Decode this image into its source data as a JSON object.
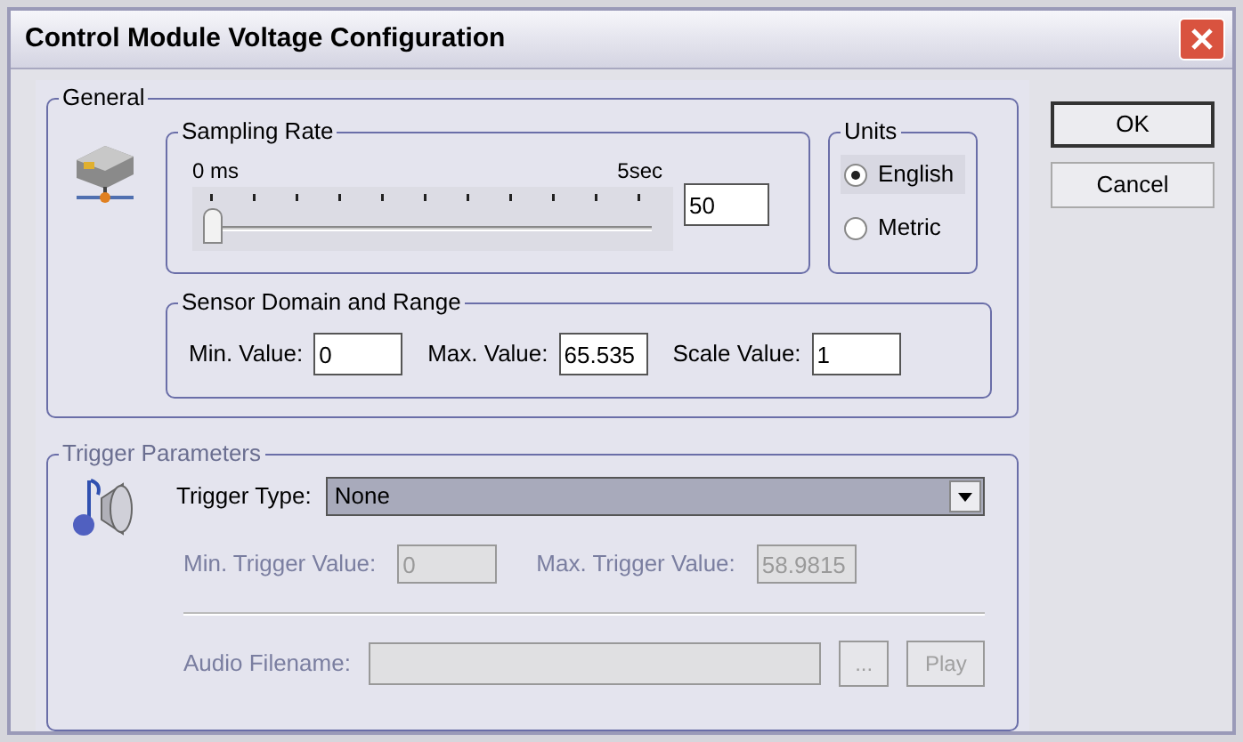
{
  "window": {
    "title": "Control Module Voltage Configuration"
  },
  "general": {
    "legend": "General",
    "sampling_rate": {
      "legend": "Sampling Rate",
      "min_label": "0 ms",
      "max_label": "5sec",
      "level": 0.01,
      "value": "50"
    },
    "units": {
      "legend": "Units",
      "options": [
        {
          "label": "English",
          "selected": true
        },
        {
          "label": "Metric",
          "selected": false
        }
      ]
    },
    "sensor": {
      "legend": "Sensor Domain and Range",
      "fields": [
        {
          "label": "Min. Value:",
          "value": "0"
        },
        {
          "label": "Max. Value:",
          "value": "65.535"
        },
        {
          "label": "Scale Value:",
          "value": "1"
        }
      ]
    }
  },
  "trigger": {
    "legend": "Trigger Parameters",
    "type_label": "Trigger Type:",
    "type_value": "None",
    "fields": [
      {
        "label": "Min. Trigger Value:",
        "value": "0",
        "disabled": true
      },
      {
        "label": "Max. Trigger Value:",
        "value": "58.9815",
        "disabled": true
      }
    ],
    "audio": {
      "label": "Audio Filename:",
      "disabled": true,
      "browse": "...",
      "play": "Play"
    }
  },
  "buttons": [
    {
      "label": "OK",
      "default": true
    },
    {
      "label": "Cancel",
      "default": false
    }
  ]
}
